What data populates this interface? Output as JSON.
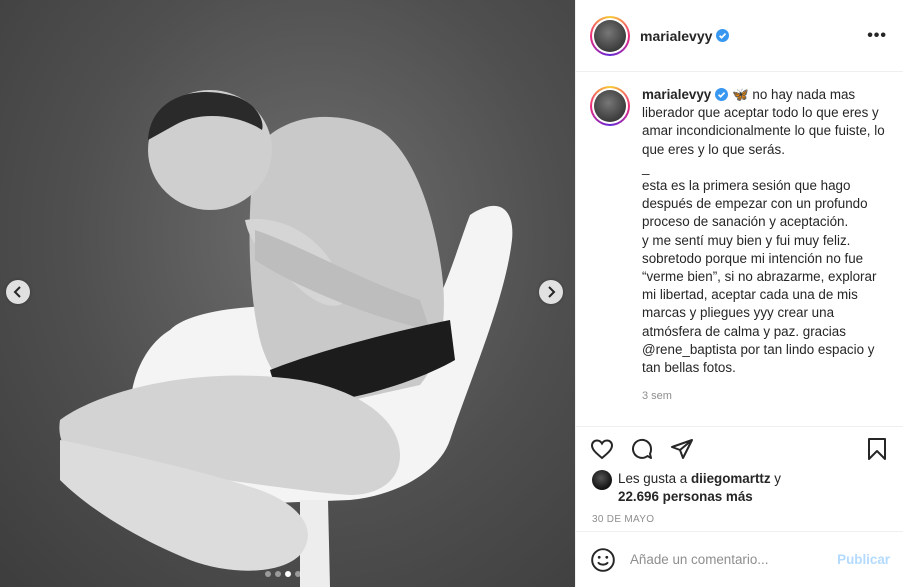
{
  "post": {
    "username": "marialevyy",
    "more_label": "•••",
    "carousel": {
      "total": 4,
      "active": 3
    }
  },
  "caption": {
    "username": "marialevyy",
    "emoji": "🦋",
    "text": " no hay nada mas liberador que aceptar todo lo que eres y amar incondicionalmente lo que fuiste, lo que eres y lo que serás.\n_\nesta es la primera sesión que hago después de empezar con un profundo proceso de sanación y aceptación.\ny me sentí muy bien y fui muy feliz. sobretodo porque mi intención no fue “verme bien”, si no abrazarme, explorar mi libertad, aceptar cada una de mis marcas y pliegues yyy crear una atmósfera de calma y paz. gracias @rene_baptista por tan lindo espacio y tan bellas fotos.",
    "time": "3 sem"
  },
  "likes": {
    "prefix": "Les gusta a ",
    "user": "diiegomarttz",
    "connector": " y",
    "count": "22.696 personas más"
  },
  "post_date": "30 DE MAYO",
  "comment": {
    "placeholder": "Añade un comentario...",
    "publish_label": "Publicar"
  },
  "icons": {
    "verified": "verified-badge-icon",
    "like": "heart-icon",
    "comment": "comment-bubble-icon",
    "share": "paper-plane-icon",
    "save": "bookmark-icon",
    "emoji": "smiley-icon",
    "prev": "chevron-left-icon",
    "next": "chevron-right-icon"
  },
  "colors": {
    "verified": "#3897f0",
    "publish_disabled": "#b3dbff",
    "muted": "#8e8e8e",
    "border": "#efefef"
  }
}
